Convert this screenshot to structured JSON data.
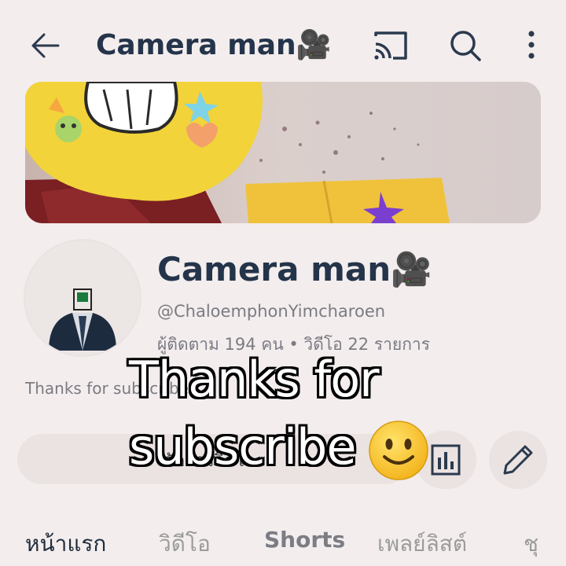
{
  "header": {
    "title": "Camera man🎥"
  },
  "channel": {
    "name": "Camera man🎥",
    "handle": "@ChaloemphonYimcharoen",
    "stats": "ผู้ติดตาม 194 คน • วิดีโอ 22 รายการ",
    "description": "Thanks for subscribe",
    "manage_videos_label": "จัดการวิดีโอ"
  },
  "overlay": {
    "line1": "Thanks for",
    "line2": "subscribe"
  },
  "tabs": [
    {
      "label": "หน้าแรก"
    },
    {
      "label": "วิดีโอ"
    },
    {
      "label": "Shorts"
    },
    {
      "label": "เพลย์ลิสต์"
    },
    {
      "label": "ชุ"
    }
  ],
  "icons": {
    "back": "arrow-left-icon",
    "cast": "cast-icon",
    "search": "search-icon",
    "more": "more-vertical-icon",
    "analytics": "bar-chart-icon",
    "edit": "pencil-icon",
    "smiley": "smiley-emoji-icon"
  },
  "colors": {
    "background": "#f3eded",
    "title": "#24344a",
    "secondary_text": "#7b7b84",
    "button_bg": "#ebe3e2"
  }
}
